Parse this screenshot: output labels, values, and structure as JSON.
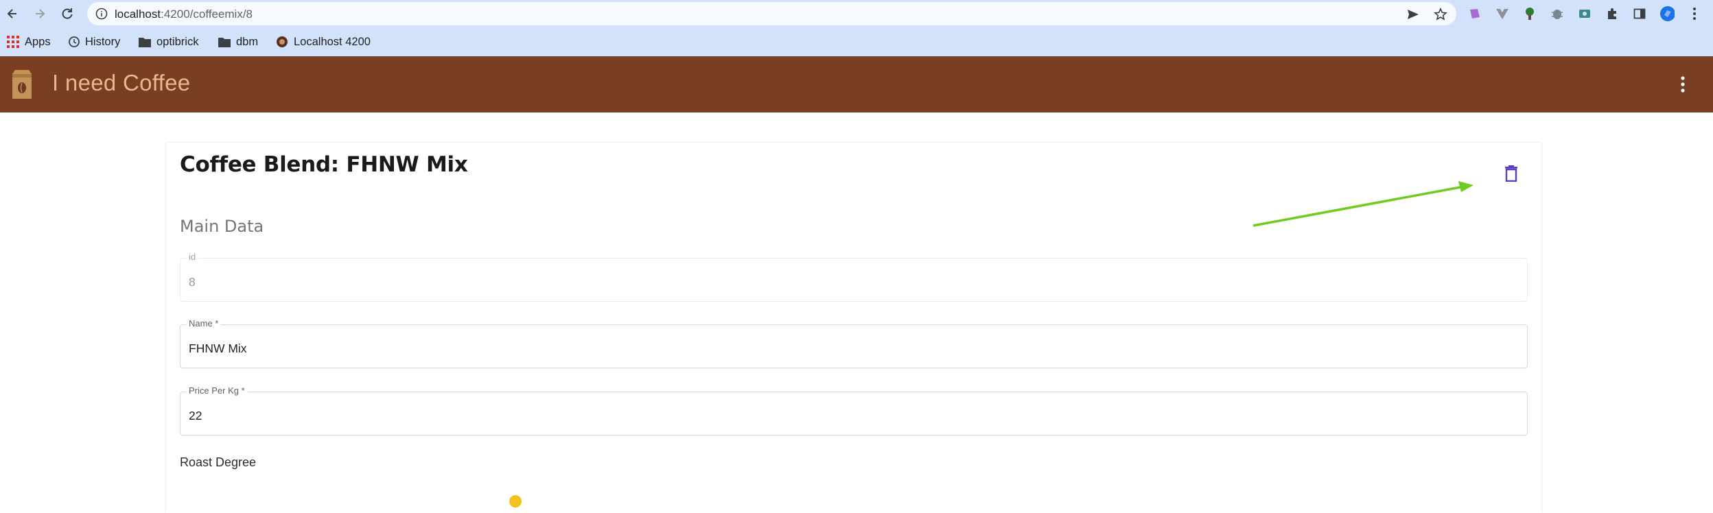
{
  "browser": {
    "url_host": "localhost",
    "url_rest": ":4200/coffeemix/8",
    "bookmarks": [
      {
        "label": "Apps",
        "icon": "apps-grid-icon"
      },
      {
        "label": "History",
        "icon": "history-icon"
      },
      {
        "label": "optibrick",
        "icon": "folder-icon"
      },
      {
        "label": "dbm",
        "icon": "folder-icon"
      },
      {
        "label": "Localhost 4200",
        "icon": "site-favicon-icon"
      }
    ]
  },
  "app": {
    "title": "I need Coffee",
    "header_color": "#7a3e22",
    "title_color": "#e6b88c"
  },
  "page": {
    "title": "Coffee Blend: FHNW Mix",
    "section_title": "Main Data",
    "fields": [
      {
        "label": "id",
        "value": "8",
        "disabled": true
      },
      {
        "label": "Name *",
        "value": "FHNW Mix",
        "disabled": false
      },
      {
        "label": "Price Per Kg *",
        "value": "22",
        "disabled": false
      }
    ],
    "roast_label": "Roast Degree",
    "accent_color": "#5b3cc4",
    "annotation_arrow_color": "#6fcb21"
  }
}
